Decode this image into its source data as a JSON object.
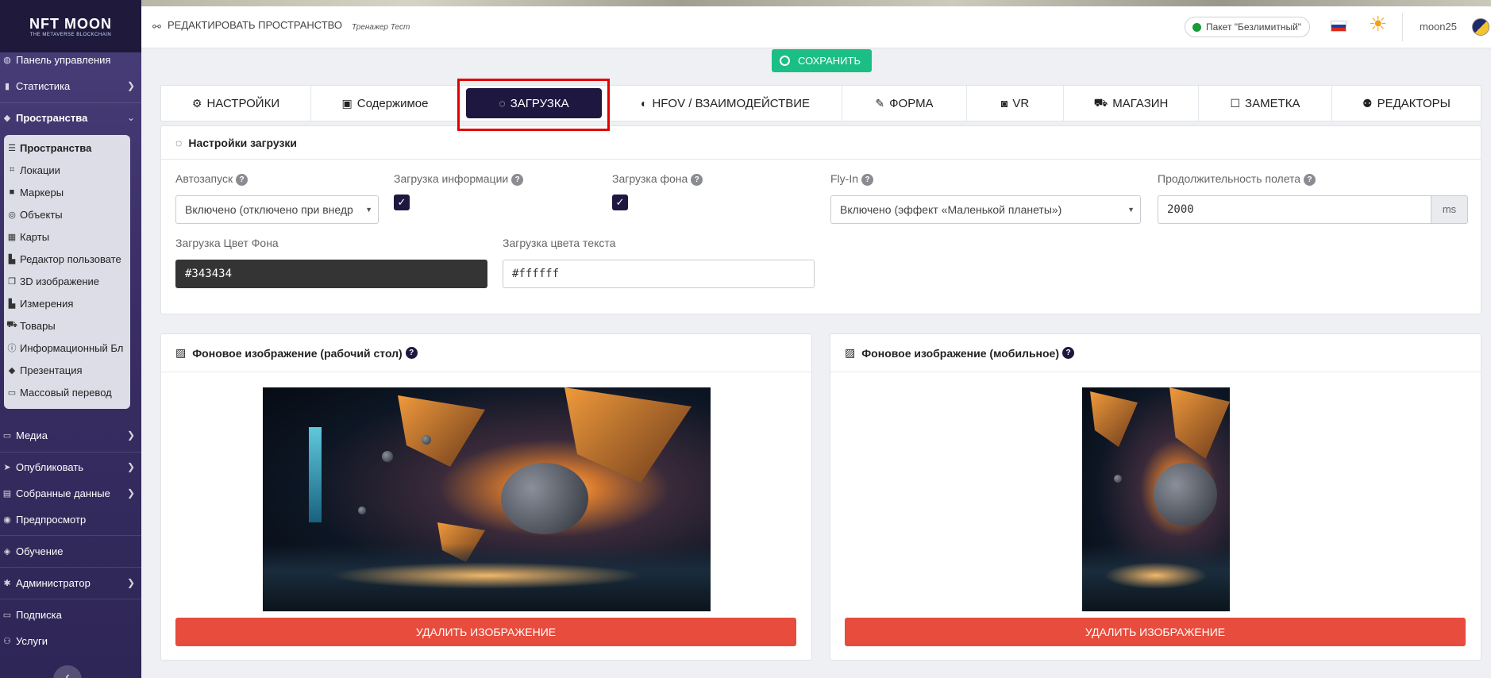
{
  "app": {
    "logo_line1": "NFT MOON",
    "logo_line2": "THE METAVERSE BLOCKCHAIN"
  },
  "sidebar": {
    "items": [
      {
        "label": "Панель управления",
        "icon": "dashboard-icon",
        "has_chevron": false
      },
      {
        "label": "Статистика",
        "icon": "chart-icon",
        "has_chevron": true
      },
      {
        "label": "Пространства",
        "icon": "spaces-icon",
        "has_chevron": true,
        "expanded": true
      },
      {
        "label": "Медиа",
        "icon": "media-icon",
        "has_chevron": true
      },
      {
        "label": "Опубликовать",
        "icon": "publish-icon",
        "has_chevron": true
      },
      {
        "label": "Собранные данные",
        "icon": "data-icon",
        "has_chevron": true
      },
      {
        "label": "Предпросмотр",
        "icon": "preview-icon",
        "has_chevron": false
      },
      {
        "label": "Обучение",
        "icon": "learning-icon",
        "has_chevron": false
      },
      {
        "label": "Администратор",
        "icon": "admin-icon",
        "has_chevron": true
      },
      {
        "label": "Подписка",
        "icon": "subscription-icon",
        "has_chevron": false
      },
      {
        "label": "Услуги",
        "icon": "services-icon",
        "has_chevron": false
      }
    ],
    "submenu": [
      {
        "label": "Пространства",
        "icon": "list-icon"
      },
      {
        "label": "Локации",
        "icon": "location-icon"
      },
      {
        "label": "Маркеры",
        "icon": "marker-icon"
      },
      {
        "label": "Объекты",
        "icon": "object-icon"
      },
      {
        "label": "Карты",
        "icon": "map-icon"
      },
      {
        "label": "Редактор пользовате",
        "icon": "user-editor-icon"
      },
      {
        "label": "3D изображение",
        "icon": "cube-icon"
      },
      {
        "label": "Измерения",
        "icon": "ruler-icon"
      },
      {
        "label": "Товары",
        "icon": "cart-icon"
      },
      {
        "label": "Информационный Бл",
        "icon": "info-icon"
      },
      {
        "label": "Презентация",
        "icon": "presentation-icon"
      },
      {
        "label": "Массовый перевод",
        "icon": "translate-icon"
      }
    ]
  },
  "header": {
    "edit_title": "РЕДАКТИРОВАТЬ ПРОСТРАНСТВО",
    "edit_subtitle": "Тренажер Тест",
    "package": "Пакет \"Безлимитный\"",
    "package_status_color": "#1a9a3a",
    "username": "moon25",
    "save_label": "СОХРАНИТЬ"
  },
  "tabs": [
    {
      "label": "НАСТРОЙКИ",
      "icon": "cogs-icon",
      "glyph": "⚙"
    },
    {
      "label": "Содержимое",
      "icon": "images-icon",
      "glyph": "▣"
    },
    {
      "label": "ЗАГРУЗКА",
      "icon": "spinner-icon",
      "glyph": "◌",
      "active": true
    },
    {
      "label": "HFOV / ВЗАИМОДЕЙСТВИЕ",
      "icon": "binoculars-icon",
      "glyph": "◐"
    },
    {
      "label": "ФОРМА",
      "icon": "form-icon",
      "glyph": "✎"
    },
    {
      "label": "VR",
      "icon": "vr-icon",
      "glyph": "◙"
    },
    {
      "label": "МАГАЗИН",
      "icon": "cart-icon",
      "glyph": "🛒"
    },
    {
      "label": "ЗАМЕТКА",
      "icon": "note-icon",
      "glyph": "☐"
    },
    {
      "label": "РЕДАКТОРЫ",
      "icon": "users-icon",
      "glyph": "👥"
    }
  ],
  "loading_settings": {
    "title": "Настройки загрузки",
    "autostart_label": "Автозапуск",
    "autostart_value": "Включено (отключено при внедр",
    "load_info_label": "Загрузка информации",
    "load_info_checked": true,
    "load_bg_label": "Загрузка фона",
    "load_bg_checked": true,
    "flyin_label": "Fly-In",
    "flyin_value": "Включено (эффект «Маленькой планеты»)",
    "duration_label": "Продолжительность полета",
    "duration_value": "2000",
    "duration_unit": "ms",
    "bg_color_label": "Загрузка Цвет Фона",
    "bg_color_value": "#343434",
    "text_color_label": "Загрузка цвета текста",
    "text_color_value": "#ffffff"
  },
  "bg_desktop": {
    "title": "Фоновое изображение (рабочий стол)",
    "delete_label": "УДАЛИТЬ ИЗОБРАЖЕНИЕ"
  },
  "bg_mobile": {
    "title": "Фоновое изображение (мобильное)",
    "delete_label": "УДАЛИТЬ ИЗОБРАЖЕНИЕ"
  },
  "colors": {
    "accent_dark": "#1e1740",
    "save_green": "#1bbf85",
    "delete_red": "#e74c3c",
    "highlight_red": "#e00000"
  }
}
